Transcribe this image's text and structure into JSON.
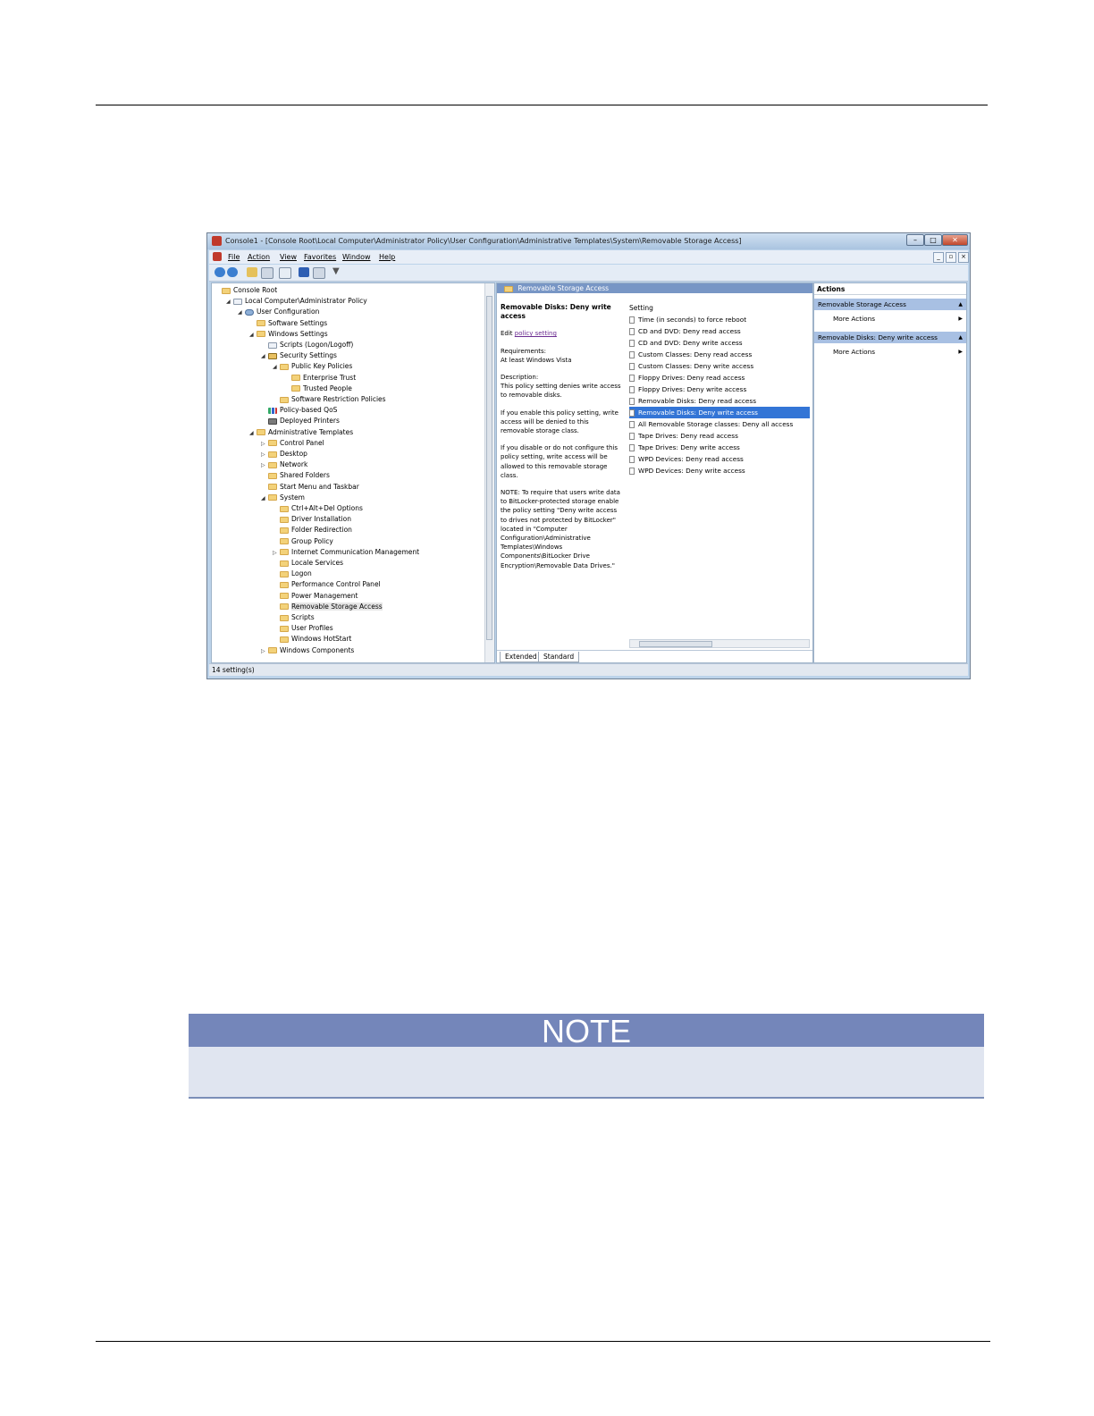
{
  "window": {
    "title": "Console1 - [Console Root\\Local Computer\\Administrator Policy\\User Configuration\\Administrative Templates\\System\\Removable Storage Access]",
    "menu": [
      "File",
      "Action",
      "View",
      "Favorites",
      "Window",
      "Help"
    ],
    "tree": [
      {
        "label": "Console Root",
        "indent": 0,
        "icon": "folder"
      },
      {
        "label": "Local Computer\\Administrator Policy",
        "indent": 1,
        "icon": "doc",
        "expanded": true
      },
      {
        "label": "User Configuration",
        "indent": 2,
        "icon": "user",
        "expanded": true
      },
      {
        "label": "Software Settings",
        "indent": 3,
        "icon": "folder"
      },
      {
        "label": "Windows Settings",
        "indent": 3,
        "icon": "folder",
        "expanded": true
      },
      {
        "label": "Scripts (Logon/Logoff)",
        "indent": 4,
        "icon": "doc"
      },
      {
        "label": "Security Settings",
        "indent": 4,
        "icon": "shield",
        "expanded": true
      },
      {
        "label": "Public Key Policies",
        "indent": 5,
        "icon": "folder",
        "expanded": true
      },
      {
        "label": "Enterprise Trust",
        "indent": 6,
        "icon": "folder"
      },
      {
        "label": "Trusted People",
        "indent": 6,
        "icon": "folder"
      },
      {
        "label": "Software Restriction Policies",
        "indent": 5,
        "icon": "folder"
      },
      {
        "label": "Policy-based QoS",
        "indent": 4,
        "icon": "chart"
      },
      {
        "label": "Deployed Printers",
        "indent": 4,
        "icon": "printer"
      },
      {
        "label": "Administrative Templates",
        "indent": 3,
        "icon": "folder",
        "expanded": true
      },
      {
        "label": "Control Panel",
        "indent": 4,
        "icon": "folder",
        "collapsed": true
      },
      {
        "label": "Desktop",
        "indent": 4,
        "icon": "folder",
        "collapsed": true
      },
      {
        "label": "Network",
        "indent": 4,
        "icon": "folder",
        "collapsed": true
      },
      {
        "label": "Shared Folders",
        "indent": 4,
        "icon": "folder"
      },
      {
        "label": "Start Menu and Taskbar",
        "indent": 4,
        "icon": "folder"
      },
      {
        "label": "System",
        "indent": 4,
        "icon": "folder",
        "expanded": true
      },
      {
        "label": "Ctrl+Alt+Del Options",
        "indent": 5,
        "icon": "folder"
      },
      {
        "label": "Driver Installation",
        "indent": 5,
        "icon": "folder"
      },
      {
        "label": "Folder Redirection",
        "indent": 5,
        "icon": "folder"
      },
      {
        "label": "Group Policy",
        "indent": 5,
        "icon": "folder"
      },
      {
        "label": "Internet Communication Management",
        "indent": 5,
        "icon": "folder",
        "collapsed": true
      },
      {
        "label": "Locale Services",
        "indent": 5,
        "icon": "folder"
      },
      {
        "label": "Logon",
        "indent": 5,
        "icon": "folder"
      },
      {
        "label": "Performance Control Panel",
        "indent": 5,
        "icon": "folder"
      },
      {
        "label": "Power Management",
        "indent": 5,
        "icon": "folder"
      },
      {
        "label": "Removable Storage Access",
        "indent": 5,
        "icon": "folder",
        "selected": true
      },
      {
        "label": "Scripts",
        "indent": 5,
        "icon": "folder"
      },
      {
        "label": "User Profiles",
        "indent": 5,
        "icon": "folder"
      },
      {
        "label": "Windows HotStart",
        "indent": 5,
        "icon": "folder"
      },
      {
        "label": "Windows Components",
        "indent": 4,
        "icon": "folder",
        "collapsed": true
      }
    ],
    "middle": {
      "header": "Removable Storage Access",
      "policy_title": "Removable Disks: Deny write access",
      "edit_prefix": "Edit",
      "edit_link": "policy setting",
      "requirements_label": "Requirements:",
      "requirements_value": "At least Windows Vista",
      "description_label": "Description:",
      "description_1": "This policy setting denies write access to removable disks.",
      "description_2": "If you enable this policy setting, write access will be denied to this removable storage class.",
      "description_3": "If you disable or do not configure this policy setting, write access will be allowed to this removable storage class.",
      "description_4": "NOTE: To require that users write data to BitLocker-protected storage enable the policy setting \"Deny write access to drives not protected by BitLocker\" located in \"Computer Configuration\\Administrative Templates\\Windows Components\\BitLocker Drive Encryption\\Removable Data Drives.\"",
      "settings_header": "Setting",
      "settings": [
        "Time (in seconds) to force reboot",
        "CD and DVD: Deny read access",
        "CD and DVD: Deny write access",
        "Custom Classes: Deny read access",
        "Custom Classes: Deny write access",
        "Floppy Drives: Deny read access",
        "Floppy Drives: Deny write access",
        "Removable Disks: Deny read access",
        "Removable Disks: Deny write access",
        "All Removable Storage classes: Deny all access",
        "Tape Drives: Deny read access",
        "Tape Drives: Deny write access",
        "WPD Devices: Deny read access",
        "WPD Devices: Deny write access"
      ],
      "selected_setting_index": 8,
      "tabs": [
        "Extended",
        "Standard"
      ]
    },
    "actions": {
      "title": "Actions",
      "section_1": "Removable Storage Access",
      "section_2": "Removable Disks: Deny write access",
      "more_actions": "More Actions"
    },
    "status": "14 setting(s)"
  },
  "note": {
    "heading": "NOTE"
  }
}
